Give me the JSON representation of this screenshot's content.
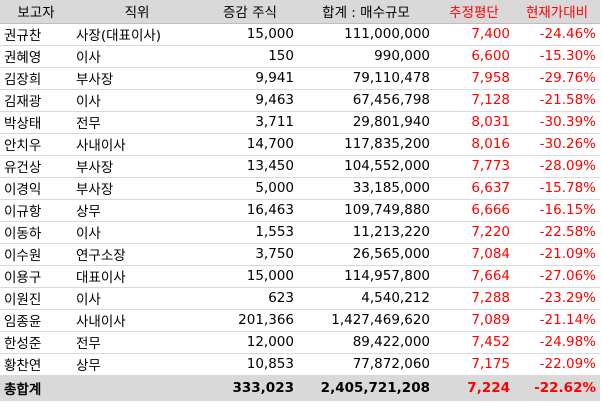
{
  "header": {
    "reporter": "보고자",
    "position": "직위",
    "change": "증감 주식",
    "total": "합계 : 매수규모",
    "avg": "추정평단",
    "vs": "현재가대비"
  },
  "rows": [
    {
      "name": "권규찬",
      "position": "사장(대표이사)",
      "change": "15,000",
      "total": "111,000,000",
      "avg": "7,400",
      "vs": "-24.46%"
    },
    {
      "name": "권혜영",
      "position": "이사",
      "change": "150",
      "total": "990,000",
      "avg": "6,600",
      "vs": "-15.30%"
    },
    {
      "name": "김장희",
      "position": "부사장",
      "change": "9,941",
      "total": "79,110,478",
      "avg": "7,958",
      "vs": "-29.76%"
    },
    {
      "name": "김재광",
      "position": "이사",
      "change": "9,463",
      "total": "67,456,798",
      "avg": "7,128",
      "vs": "-21.58%"
    },
    {
      "name": "박상태",
      "position": "전무",
      "change": "3,711",
      "total": "29,801,940",
      "avg": "8,031",
      "vs": "-30.39%"
    },
    {
      "name": "안치우",
      "position": "사내이사",
      "change": "14,700",
      "total": "117,835,200",
      "avg": "8,016",
      "vs": "-30.26%"
    },
    {
      "name": "유건상",
      "position": "부사장",
      "change": "13,450",
      "total": "104,552,000",
      "avg": "7,773",
      "vs": "-28.09%"
    },
    {
      "name": "이경익",
      "position": "부사장",
      "change": "5,000",
      "total": "33,185,000",
      "avg": "6,637",
      "vs": "-15.78%"
    },
    {
      "name": "이규항",
      "position": "상무",
      "change": "16,463",
      "total": "109,749,880",
      "avg": "6,666",
      "vs": "-16.15%"
    },
    {
      "name": "이동하",
      "position": "이사",
      "change": "1,553",
      "total": "11,213,220",
      "avg": "7,220",
      "vs": "-22.58%"
    },
    {
      "name": "이수원",
      "position": "연구소장",
      "change": "3,750",
      "total": "26,565,000",
      "avg": "7,084",
      "vs": "-21.09%"
    },
    {
      "name": "이용구",
      "position": "대표이사",
      "change": "15,000",
      "total": "114,957,800",
      "avg": "7,664",
      "vs": "-27.06%"
    },
    {
      "name": "이원진",
      "position": "이사",
      "change": "623",
      "total": "4,540,212",
      "avg": "7,288",
      "vs": "-23.29%"
    },
    {
      "name": "임종윤",
      "position": "사내이사",
      "change": "201,366",
      "total": "1,427,469,620",
      "avg": "7,089",
      "vs": "-21.14%"
    },
    {
      "name": "한성준",
      "position": "전무",
      "change": "12,000",
      "total": "89,422,000",
      "avg": "7,452",
      "vs": "-24.98%"
    },
    {
      "name": "황찬연",
      "position": "상무",
      "change": "10,853",
      "total": "77,872,060",
      "avg": "7,175",
      "vs": "-22.09%"
    }
  ],
  "footer": {
    "label": "총합계",
    "position": "",
    "change": "333,023",
    "total": "2,405,721,208",
    "avg": "7,224",
    "vs": "-22.62%"
  }
}
